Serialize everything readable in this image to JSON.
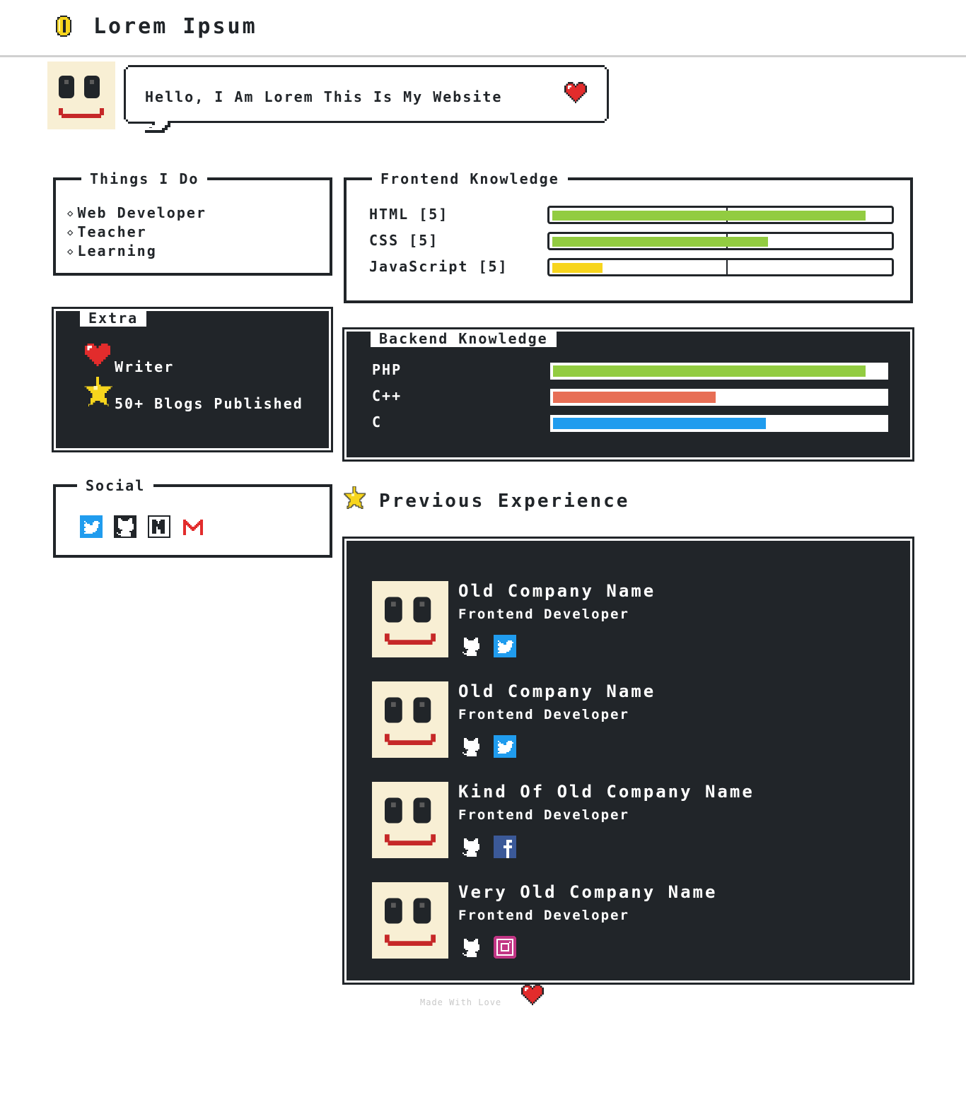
{
  "header": {
    "title": "Lorem Ipsum",
    "logo_icon": "coin-icon"
  },
  "greeting": {
    "text": "Hello, I Am Lorem This Is My Website",
    "icon": "heart-icon"
  },
  "things": {
    "title": "Things I Do",
    "items": [
      "Web Developer",
      "Teacher",
      "Learning"
    ]
  },
  "frontend": {
    "title": "Frontend Knowledge",
    "skills": [
      {
        "label": "HTML [5]",
        "level": 0.93,
        "color": "#92cc41"
      },
      {
        "label": "CSS [5]",
        "level": 0.64,
        "color": "#92cc41"
      },
      {
        "label": "JavaScript [5]",
        "level": 0.15,
        "color": "#f7d51d"
      }
    ]
  },
  "extra": {
    "title": "Extra",
    "writer": "Writer",
    "blogs": "50+ Blogs Published"
  },
  "backend": {
    "title": "Backend Knowledge",
    "skills": [
      {
        "label": "PHP",
        "level": 0.94,
        "color": "#92cc41"
      },
      {
        "label": "C++",
        "level": 0.49,
        "color": "#e76e55"
      },
      {
        "label": "C",
        "level": 0.64,
        "color": "#209cee"
      }
    ]
  },
  "social": {
    "title": "Social",
    "icons": [
      "twitter-icon",
      "github-icon",
      "medium-icon",
      "gmail-icon"
    ]
  },
  "experience": {
    "title": "Previous Experience",
    "jobs": [
      {
        "company": "Old Company Name",
        "role": "Frontend Developer",
        "icons": [
          "github-icon",
          "twitter-icon"
        ]
      },
      {
        "company": "Old Company Name",
        "role": "Frontend Developer",
        "icons": [
          "github-icon",
          "twitter-icon"
        ]
      },
      {
        "company": "Kind Of Old Company Name",
        "role": "Frontend Developer",
        "icons": [
          "github-icon",
          "facebook-icon"
        ]
      },
      {
        "company": "Very Old Company Name",
        "role": "Frontend Developer",
        "icons": [
          "github-icon",
          "instagram-icon"
        ]
      }
    ]
  },
  "footer": {
    "text": "Made With Love",
    "icon": "heart-icon"
  }
}
